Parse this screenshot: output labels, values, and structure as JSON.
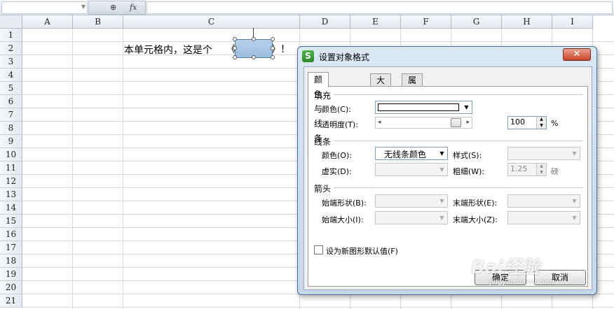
{
  "formula_bar": {
    "zoom_icon": "zoom-icon",
    "fx_label": "fx"
  },
  "columns": [
    "A",
    "B",
    "C",
    "D",
    "E",
    "F",
    "G",
    "H",
    "I"
  ],
  "rows": [
    "1",
    "2",
    "3",
    "4",
    "5",
    "6",
    "7",
    "8",
    "9",
    "10",
    "11",
    "12",
    "13",
    "14",
    "15",
    "16",
    "17",
    "18",
    "19",
    "20",
    "21"
  ],
  "cell_c2": {
    "text": "本单元格内，这是个",
    "bracket_left": "《",
    "bracket_right": "》！"
  },
  "dialog": {
    "title": "设置对象格式",
    "logo": "S",
    "close": "✕",
    "tabs": [
      "颜色与线条",
      "大小",
      "属性"
    ],
    "fill": {
      "section": "填充",
      "color_label": "颜色(C):",
      "transparency_label": "透明度(T):",
      "transparency_value": "100",
      "transparency_unit": "%"
    },
    "line": {
      "section": "线条",
      "color_label": "颜色(O):",
      "color_value": "无线条颜色",
      "style_label": "样式(S):",
      "dash_label": "虚实(D):",
      "weight_label": "粗细(W):",
      "weight_value": "1.25",
      "weight_unit": "磅"
    },
    "arrows": {
      "section": "箭头",
      "begin_style_label": "始端形状(B):",
      "end_style_label": "末端形状(E):",
      "begin_size_label": "始端大小(I):",
      "end_size_label": "末端大小(Z):"
    },
    "default_checkbox": "设为新图形默认值(F)",
    "ok": "确定",
    "cancel": "取消"
  },
  "watermark": {
    "text": "Bai经验",
    "sub": "jingyan.baidu.com"
  }
}
